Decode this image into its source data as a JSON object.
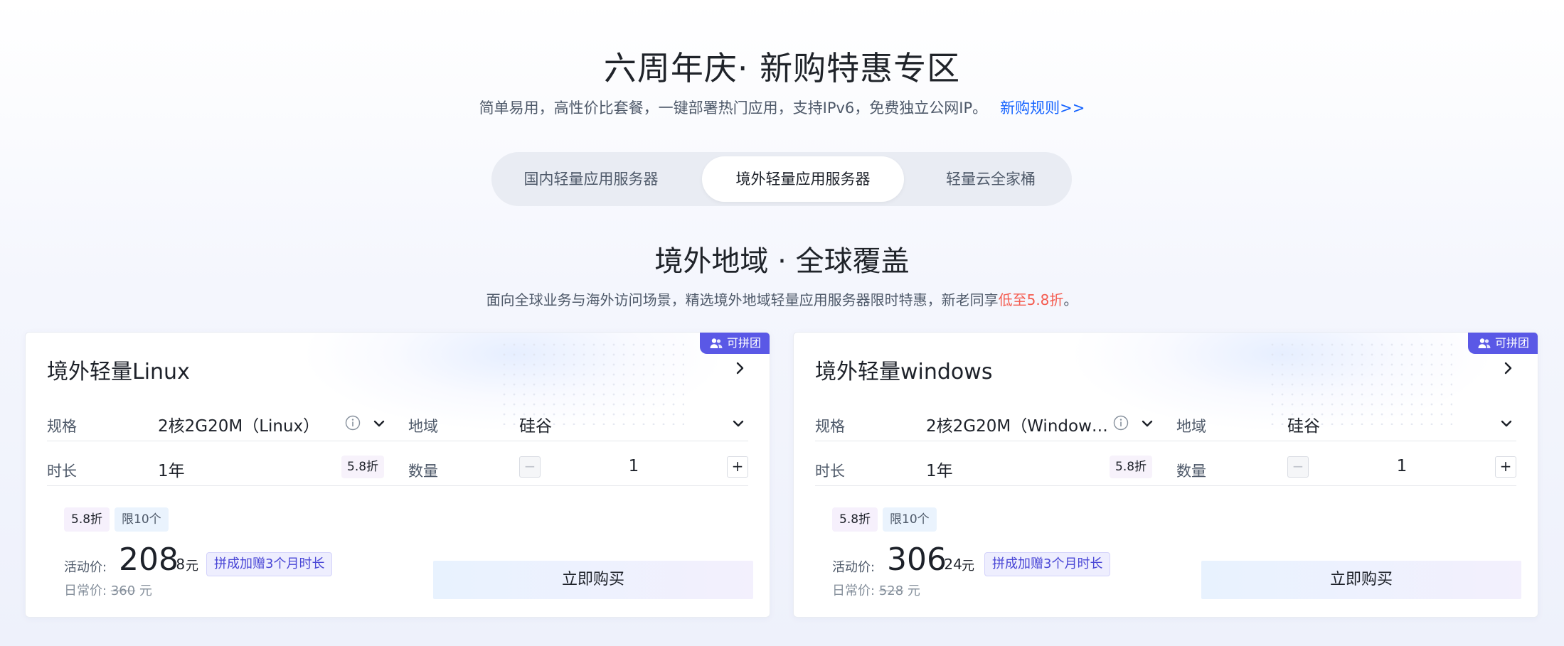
{
  "header": {
    "title": "六周年庆· 新购特惠专区",
    "subtitle": "简单易用，高性价比套餐，一键部署热门应用，支持IPv6，免费独立公网IP。",
    "rules_link": "新购规则>>"
  },
  "tabs": [
    {
      "label": "国内轻量应用服务器",
      "active": false
    },
    {
      "label": "境外轻量应用服务器",
      "active": true
    },
    {
      "label": "轻量云全家桶",
      "active": false
    }
  ],
  "section": {
    "title": "境外地域 · 全球覆盖",
    "subtitle_prefix": "面向全球业务与海外访问场景，精选境外地域轻量应用服务器限时特惠，新老同享",
    "subtitle_highlight": "低至5.8折",
    "subtitle_suffix": "。"
  },
  "colors": {
    "accent_blue": "#1664ff",
    "highlight_red": "#f45b4f",
    "badge_purple": "#5a58e6"
  },
  "cards": [
    {
      "badge": "可拼团",
      "title": "境外轻量Linux",
      "spec_label": "规格",
      "spec_value": "2核2G20M（Linux）",
      "region_label": "地域",
      "region_value": "硅谷",
      "duration_label": "时长",
      "duration_value": "1年",
      "duration_discount": "5.8折",
      "quantity_label": "数量",
      "quantity_value": "1",
      "tag_discount": "5.8折",
      "tag_limit": "限10个",
      "price_label": "活动价:",
      "price_int": "208",
      "price_dec": ".8",
      "price_unit": "元",
      "group_tag": "拼成加赠3个月时长",
      "old_price_label": "日常价:",
      "old_price": "360",
      "old_price_unit": "元",
      "buy_label": "立即购买"
    },
    {
      "badge": "可拼团",
      "title": "境外轻量windows",
      "spec_label": "规格",
      "spec_value": "2核2G20M（Window…",
      "region_label": "地域",
      "region_value": "硅谷",
      "duration_label": "时长",
      "duration_value": "1年",
      "duration_discount": "5.8折",
      "quantity_label": "数量",
      "quantity_value": "1",
      "tag_discount": "5.8折",
      "tag_limit": "限10个",
      "price_label": "活动价:",
      "price_int": "306",
      "price_dec": ".24",
      "price_unit": "元",
      "group_tag": "拼成加赠3个月时长",
      "old_price_label": "日常价:",
      "old_price": "528",
      "old_price_unit": "元",
      "buy_label": "立即购买"
    }
  ]
}
